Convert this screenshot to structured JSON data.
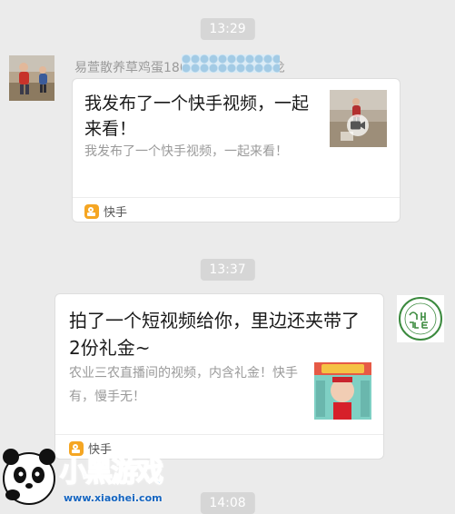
{
  "timestamps": [
    "13:29",
    "13:37",
    "14:08"
  ],
  "message1": {
    "sender": "易萱散养草鸡蛋180",
    "sender_suffix": "7龙",
    "title": "我发布了一个快手视频，一起来看！",
    "description": "我发布了一个快手视频，一起来看！",
    "app_name": "快手"
  },
  "message2": {
    "title": "拍了一个短视频给你，里边还夹带了2份礼金~",
    "description": "农业三农直播间的视频，内含礼金！快手有，慢手无！",
    "app_name": "快手"
  },
  "watermark": {
    "logo_text": "小黑游戏",
    "url": "www.xiaohei.com"
  },
  "icons": {
    "video": "video-camera-icon",
    "app": "kuaishou-app-icon"
  },
  "colors": {
    "background": "#ebebeb",
    "timestamp_bg": "#d6d6d6",
    "card_bg": "#ffffff",
    "app_icon": "#f5a623",
    "avatar_green": "#3b8a3e"
  }
}
